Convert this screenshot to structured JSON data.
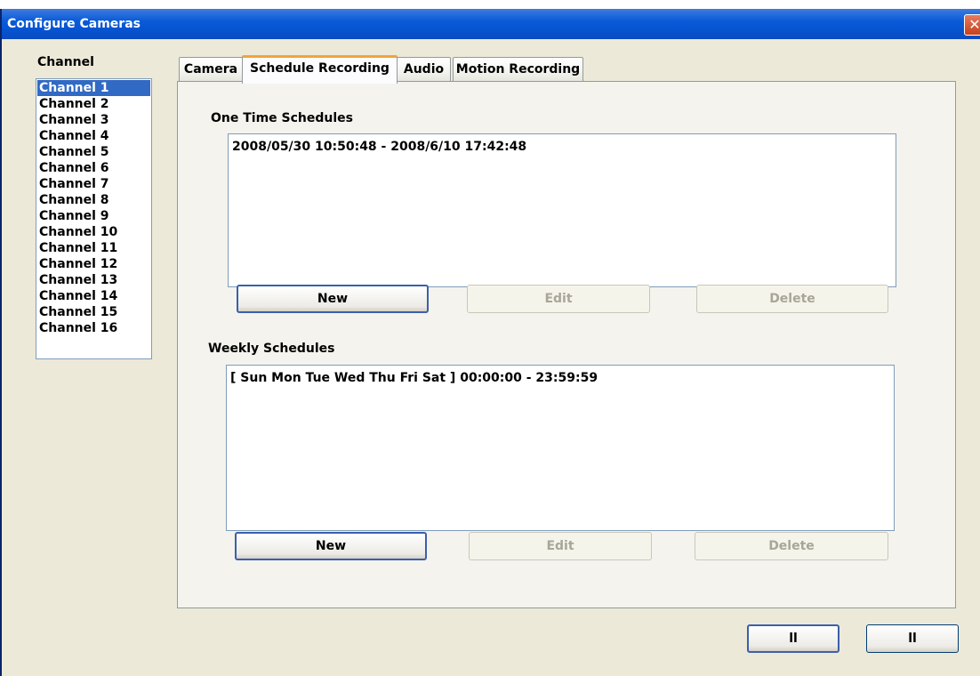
{
  "window": {
    "title": "Configure Cameras",
    "close_icon": "✕"
  },
  "channels": {
    "label": "Channel",
    "items": [
      "Channel 1",
      "Channel 2",
      "Channel 3",
      "Channel 4",
      "Channel 5",
      "Channel 6",
      "Channel 7",
      "Channel 8",
      "Channel 9",
      "Channel 10",
      "Channel 11",
      "Channel 12",
      "Channel 13",
      "Channel 14",
      "Channel 15",
      "Channel 16"
    ],
    "selected": "Channel 1"
  },
  "tabs": [
    "Camera",
    "Schedule Recording",
    "Audio",
    "Motion Recording"
  ],
  "active_tab": "Schedule Recording",
  "one_time": {
    "label": "One Time Schedules",
    "entries": [
      "2008/05/30 10:50:48 - 2008/6/10 17:42:48"
    ],
    "new_label": "New",
    "edit_label": "Edit",
    "delete_label": "Delete"
  },
  "weekly": {
    "label": "Weekly Schedules",
    "entries": [
      "[ Sun Mon Tue Wed Thu Fri Sat ] 00:00:00 - 23:59:59"
    ],
    "new_label": "New",
    "edit_label": "Edit",
    "delete_label": "Delete"
  },
  "footer": {
    "ok_label": "ll",
    "cancel_label": "ll"
  },
  "colors": {
    "titlebar": "#0a5bd8",
    "dialog_bg": "#ece9d8",
    "selection": "#316ac5",
    "active_tab_accent": "#f0a43c"
  }
}
